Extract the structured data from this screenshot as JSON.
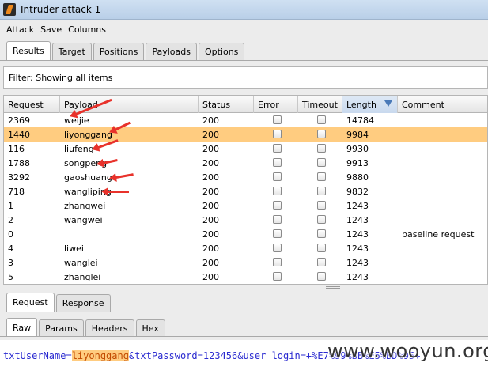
{
  "window": {
    "title": "Intruder attack 1"
  },
  "menu": [
    "Attack",
    "Save",
    "Columns"
  ],
  "main_tabs": [
    "Results",
    "Target",
    "Positions",
    "Payloads",
    "Options"
  ],
  "filter": {
    "text": "Filter:  Showing all items"
  },
  "table": {
    "columns": [
      "Request",
      "Payload",
      "Status",
      "Error",
      "Timeout",
      "Length",
      "Comment"
    ],
    "sorted_column": "Length",
    "rows": [
      {
        "request": "2369",
        "payload": "weijie",
        "status": "200",
        "error": false,
        "timeout": false,
        "length": "14784",
        "comment": ""
      },
      {
        "request": "1440",
        "payload": "liyonggang",
        "status": "200",
        "error": false,
        "timeout": false,
        "length": "9984",
        "comment": "",
        "selected": true
      },
      {
        "request": "116",
        "payload": "liufeng",
        "status": "200",
        "error": false,
        "timeout": false,
        "length": "9930",
        "comment": ""
      },
      {
        "request": "1788",
        "payload": "songpeng",
        "status": "200",
        "error": false,
        "timeout": false,
        "length": "9913",
        "comment": ""
      },
      {
        "request": "3292",
        "payload": "gaoshuang",
        "status": "200",
        "error": false,
        "timeout": false,
        "length": "9880",
        "comment": ""
      },
      {
        "request": "718",
        "payload": "wangliping",
        "status": "200",
        "error": false,
        "timeout": false,
        "length": "9832",
        "comment": ""
      },
      {
        "request": "1",
        "payload": "zhangwei",
        "status": "200",
        "error": false,
        "timeout": false,
        "length": "1243",
        "comment": ""
      },
      {
        "request": "2",
        "payload": "wangwei",
        "status": "200",
        "error": false,
        "timeout": false,
        "length": "1243",
        "comment": ""
      },
      {
        "request": "0",
        "payload": "",
        "status": "200",
        "error": false,
        "timeout": false,
        "length": "1243",
        "comment": "baseline request"
      },
      {
        "request": "4",
        "payload": "liwei",
        "status": "200",
        "error": false,
        "timeout": false,
        "length": "1243",
        "comment": ""
      },
      {
        "request": "3",
        "payload": "wanglei",
        "status": "200",
        "error": false,
        "timeout": false,
        "length": "1243",
        "comment": ""
      },
      {
        "request": "5",
        "payload": "zhanglei",
        "status": "200",
        "error": false,
        "timeout": false,
        "length": "1243",
        "comment": ""
      }
    ]
  },
  "detail_tabs": [
    "Request",
    "Response"
  ],
  "view_tabs": [
    "Raw",
    "Params",
    "Headers",
    "Hex"
  ],
  "request_body": {
    "prefix": "txtUserName=",
    "highlight": "liyonggang",
    "suffix": "&txtPassword=123456&user_login=+%E7%99%BB%E5%BD%95+"
  },
  "watermark": "www.wooyun.org",
  "colors": {
    "selected_row": "#ffcc80",
    "annotation_arrow": "#e8322b",
    "request_text": "#2a2ad0"
  }
}
